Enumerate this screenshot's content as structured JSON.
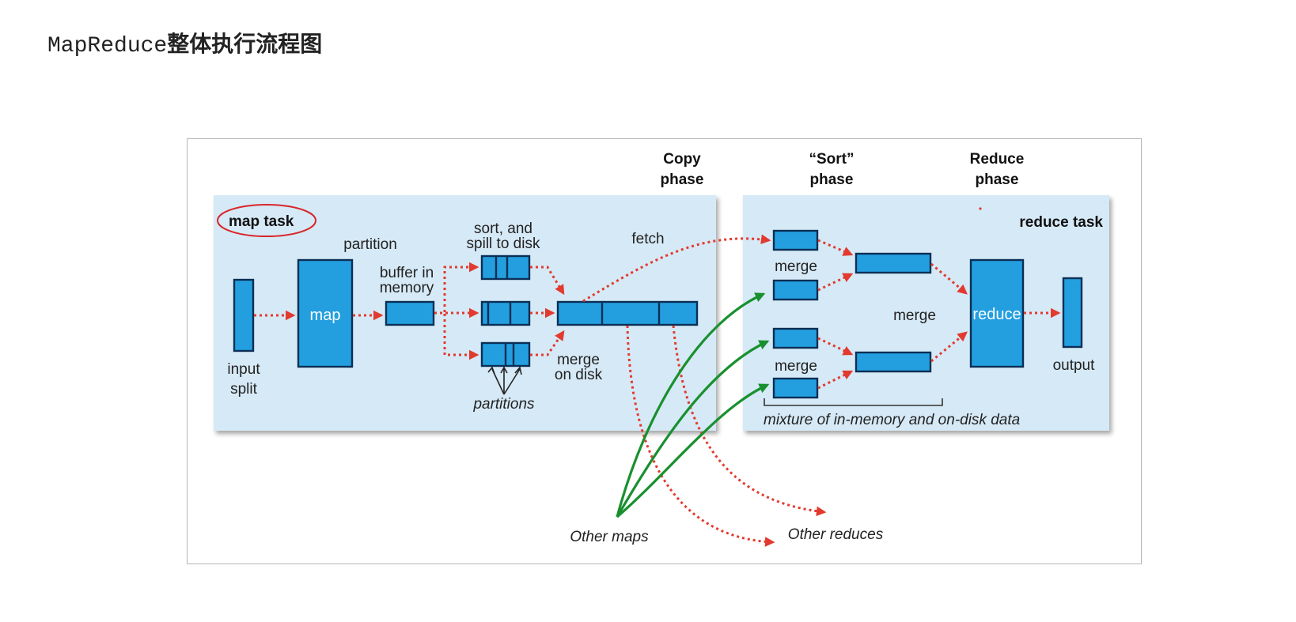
{
  "title": {
    "prefix": "MapReduce",
    "suffix": "整体执行流程图"
  },
  "phases": {
    "copy": [
      "Copy",
      "phase"
    ],
    "sort": [
      "“Sort”",
      "phase"
    ],
    "reduce": [
      "Reduce",
      "phase"
    ]
  },
  "map_task": {
    "title": "map task",
    "partition": "partition",
    "sort_spill": [
      "sort, and",
      "spill to disk"
    ],
    "fetch": "fetch",
    "buffer": [
      "buffer in",
      "memory"
    ],
    "map": "map",
    "merge_on_disk": [
      "merge",
      "on disk"
    ],
    "input_split": [
      "input",
      "split"
    ],
    "partitions": "partitions"
  },
  "reduce_task": {
    "title": "reduce task",
    "merge_top": "merge",
    "merge_bottom": "merge",
    "merge_mid": "merge",
    "reduce": "reduce",
    "output": "output",
    "mixture": "mixture of in-memory and on-disk data"
  },
  "external": {
    "other_maps": "Other maps",
    "other_reduces": "Other reduces"
  },
  "colors": {
    "panel": "#d6e9f6",
    "block": "#239fe0",
    "block_border": "#0b2f55",
    "red_arrow": "#e23a2f",
    "green_arrow": "#19902f",
    "highlight": "#d8262a"
  }
}
